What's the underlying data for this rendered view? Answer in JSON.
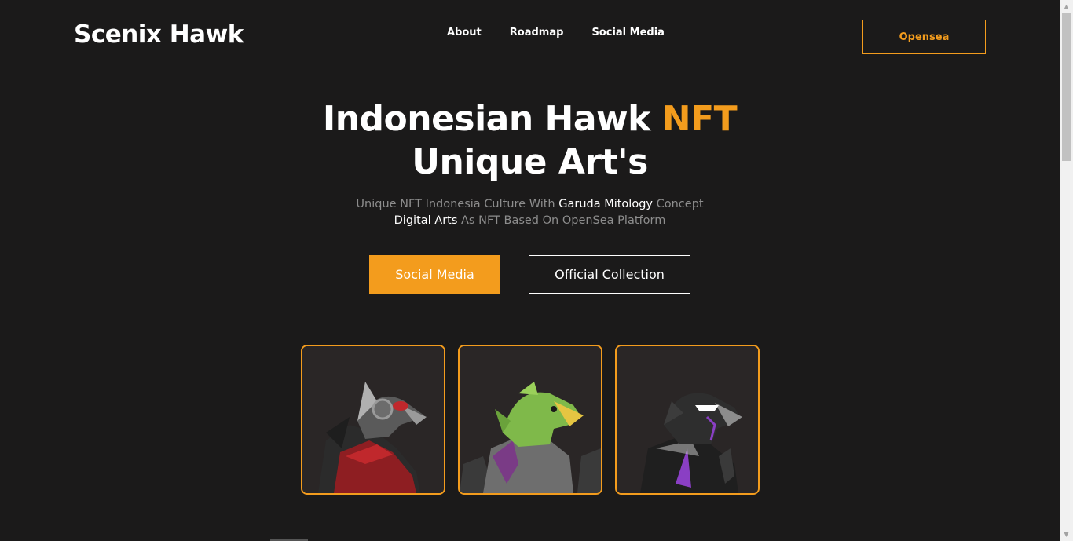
{
  "header": {
    "logo": "Scenix Hawk",
    "nav": [
      "About",
      "Roadmap",
      "Social Media"
    ],
    "cta": "Opensea"
  },
  "hero": {
    "title_part1": "Indonesian Hawk ",
    "title_accent": "NFT",
    "title_line2": "Unique Art's",
    "sub_line1_a": "Unique NFT Indonesia Culture With ",
    "sub_line1_hl": "Garuda Mitology",
    "sub_line1_b": " Concept",
    "sub_line2_hl": "Digital Arts",
    "sub_line2_b": " As NFT Based On OpenSea Platform",
    "primary_button": "Social Media",
    "secondary_button": "Official Collection"
  },
  "cards": [
    {
      "icon": "hawk-red-armor-icon",
      "accent": "#c0282c"
    },
    {
      "icon": "hawk-green-armor-icon",
      "accent": "#7fb94a"
    },
    {
      "icon": "hawk-black-purple-icon",
      "accent": "#8a3fc4"
    }
  ],
  "colors": {
    "background": "#1b1a1a",
    "accent": "#f39c1d",
    "muted_text": "#8d8d8d"
  }
}
